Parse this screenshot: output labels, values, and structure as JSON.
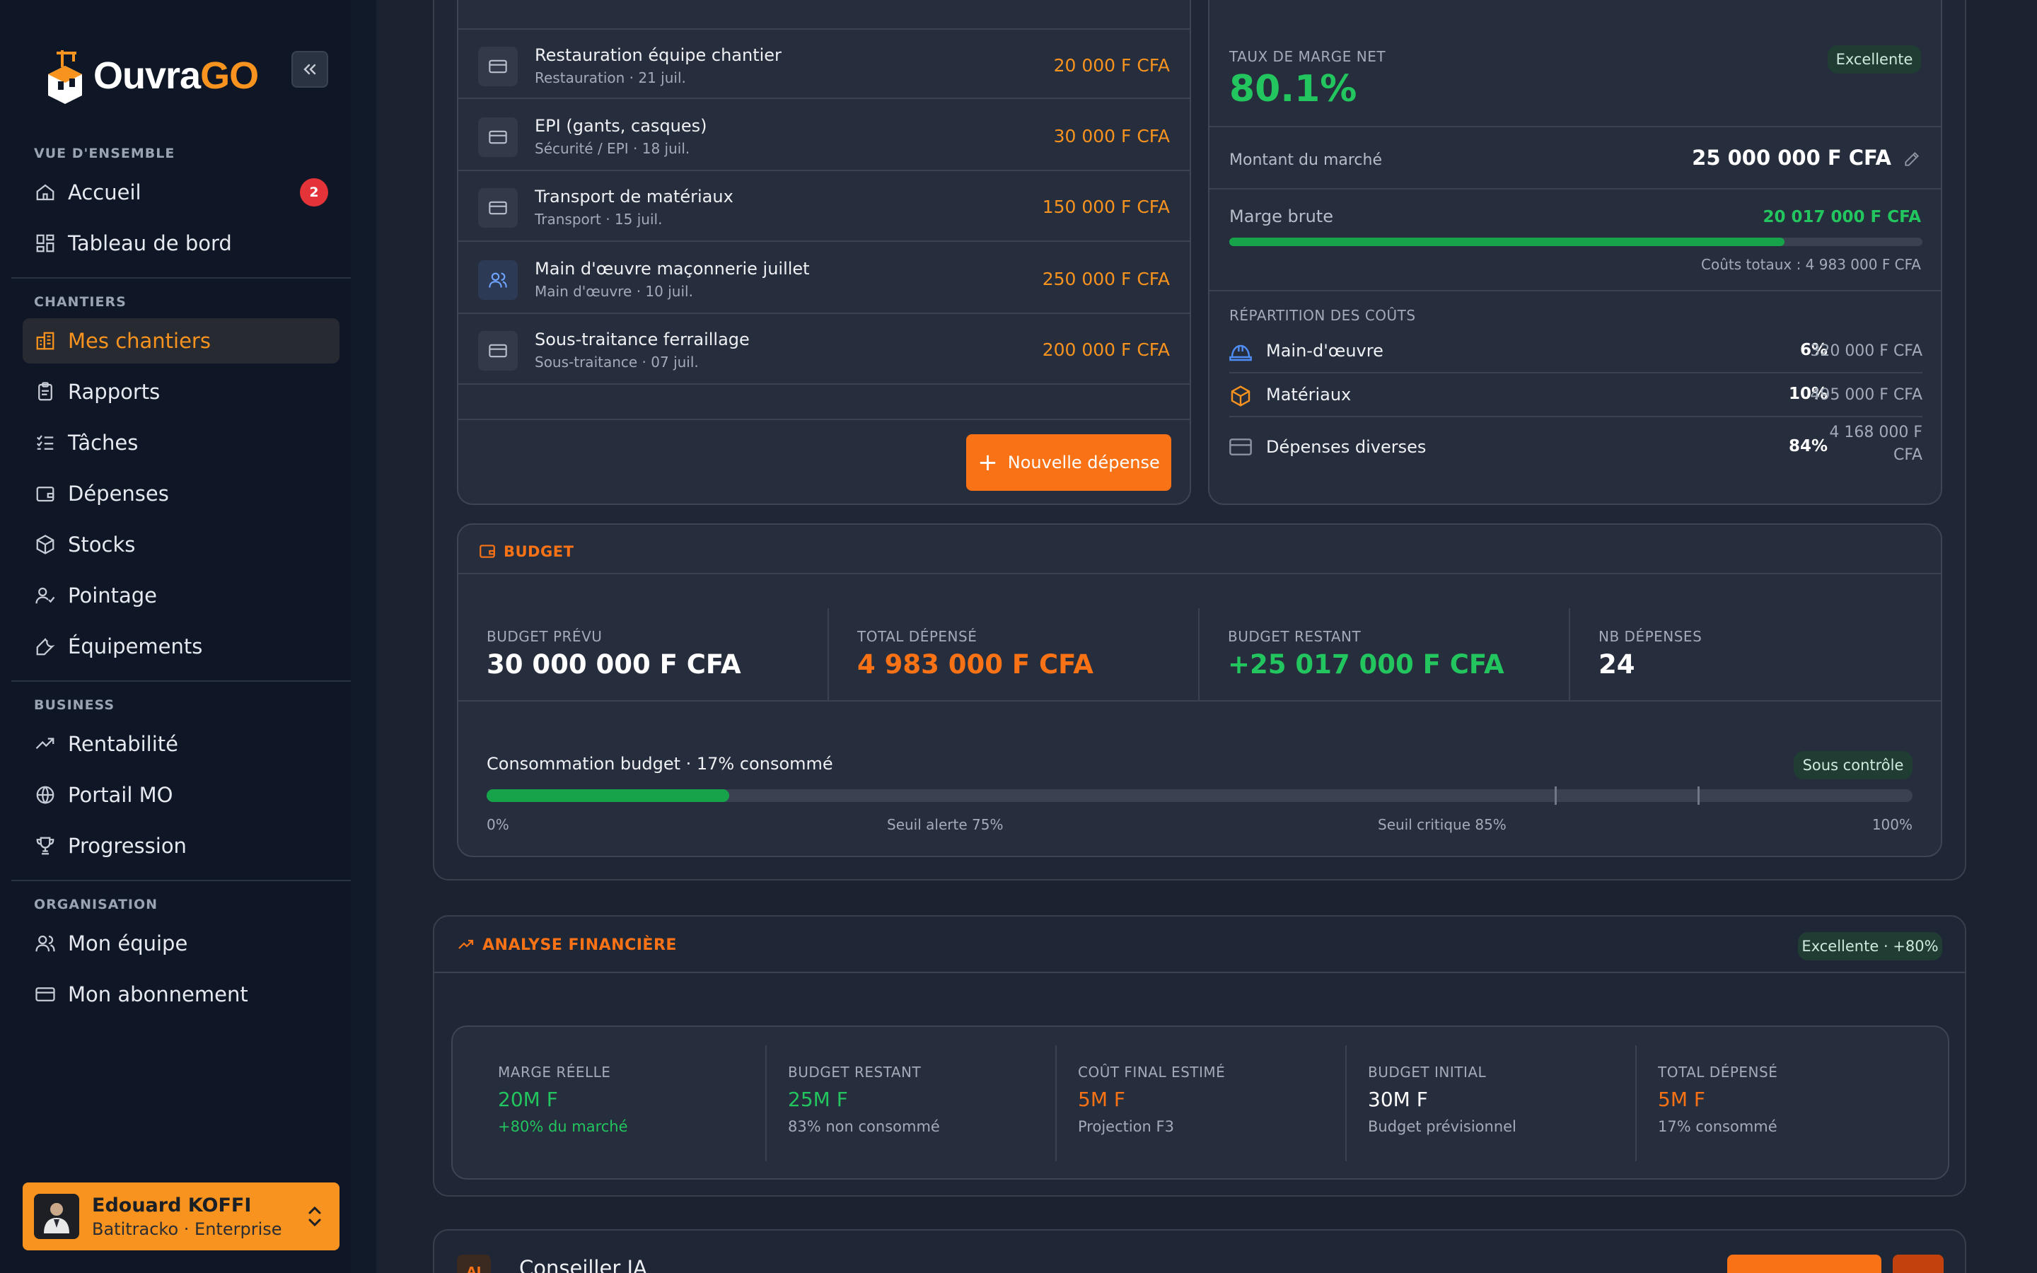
{
  "brand": {
    "name_part1": "Ouvra",
    "name_part2": "GO"
  },
  "sidebar": {
    "sections": [
      {
        "title": "VUE D'ENSEMBLE"
      },
      {
        "title": "CHANTIERS"
      },
      {
        "title": "BUSINESS"
      },
      {
        "title": "ORGANISATION"
      }
    ],
    "items": [
      {
        "label": "Accueil",
        "icon": "home-icon",
        "badge": "2"
      },
      {
        "label": "Tableau de bord",
        "icon": "dashboard-icon"
      },
      {
        "label": "Mes chantiers",
        "icon": "buildings-icon",
        "active": true
      },
      {
        "label": "Rapports",
        "icon": "clipboard-icon"
      },
      {
        "label": "Tâches",
        "icon": "checklist-icon"
      },
      {
        "label": "Dépenses",
        "icon": "wallet-icon"
      },
      {
        "label": "Stocks",
        "icon": "box-icon"
      },
      {
        "label": "Pointage",
        "icon": "user-check-icon"
      },
      {
        "label": "Équipements",
        "icon": "wrench-icon"
      },
      {
        "label": "Rentabilité",
        "icon": "trend-up-icon"
      },
      {
        "label": "Portail MO",
        "icon": "globe-icon"
      },
      {
        "label": "Progression",
        "icon": "trophy-icon"
      },
      {
        "label": "Mon équipe",
        "icon": "users-icon"
      },
      {
        "label": "Mon abonnement",
        "icon": "card-icon"
      }
    ],
    "user": {
      "name": "Edouard KOFFI",
      "subtitle": "Batitracko · Enterprise"
    }
  },
  "expenses": {
    "rows": [
      {
        "title": "Restauration équipe chantier",
        "sub": "Restauration · 21 juil.",
        "amount": "20 000 F CFA",
        "icon": "card-icon"
      },
      {
        "title": "EPI (gants, casques)",
        "sub": "Sécurité / EPI · 18 juil.",
        "amount": "30 000 F CFA",
        "icon": "card-icon"
      },
      {
        "title": "Transport de matériaux",
        "sub": "Transport · 15 juil.",
        "amount": "150 000 F CFA",
        "icon": "card-icon"
      },
      {
        "title": "Main d'œuvre maçonnerie juillet",
        "sub": "Main d'œuvre · 10 juil.",
        "amount": "250 000 F CFA",
        "icon": "users-icon"
      },
      {
        "title": "Sous-traitance ferraillage",
        "sub": "Sous-traitance · 07 juil.",
        "amount": "200 000 F CFA",
        "icon": "card-icon"
      }
    ],
    "new_button": "Nouvelle dépense"
  },
  "margin": {
    "net_label": "TAUX DE MARGE NET",
    "net_value": "80.1%",
    "net_badge": "Excellente",
    "market_label": "Montant du marché",
    "market_value": "25 000 000 F CFA",
    "gross_label": "Marge brute",
    "gross_value": "20 017 000 F CFA",
    "gross_fraction": 0.801,
    "total_costs": "Coûts totaux : 4 983 000 F CFA",
    "breakdown_title": "RÉPARTITION DES COÛTS",
    "breakdown": [
      {
        "label": "Main-d'œuvre",
        "pct": "6%",
        "amount": "320 000 F CFA",
        "icon": "helmet-icon"
      },
      {
        "label": "Matériaux",
        "pct": "10%",
        "amount": "495 000 F CFA",
        "icon": "box-icon"
      },
      {
        "label": "Dépenses diverses",
        "pct": "84%",
        "amount_line1": "4 168 000 F",
        "amount_line2": "CFA",
        "icon": "card-icon"
      }
    ]
  },
  "budget": {
    "title": "BUDGET",
    "stats": [
      {
        "label": "BUDGET PRÉVU",
        "value": "30 000 000 F CFA",
        "color": "#ffffff"
      },
      {
        "label": "TOTAL DÉPENSÉ",
        "value": "4 983 000 F CFA",
        "color": "#f97316"
      },
      {
        "label": "BUDGET RESTANT",
        "value": "+25 017 000 F CFA",
        "color": "#22c55e"
      },
      {
        "label": "NB DÉPENSES",
        "value": "24",
        "color": "#ffffff"
      }
    ],
    "consumption_label": "Consommation budget · 17% consommé",
    "consumption_fraction": 0.17,
    "status_badge": "Sous contrôle",
    "scale": {
      "start": "0%",
      "alert": "Seuil alerte 75%",
      "critical": "Seuil critique 85%",
      "end": "100%"
    }
  },
  "analysis": {
    "title": "ANALYSE FINANCIÈRE",
    "badge": "Excellente · +80%",
    "cards": [
      {
        "label": "MARGE RÉELLE",
        "value": "20M F",
        "sub": "+80% du marché",
        "value_color": "#22c55e",
        "sub_color": "#22c55e"
      },
      {
        "label": "BUDGET RESTANT",
        "value": "25M F",
        "sub": "83% non consommé",
        "value_color": "#22c55e",
        "sub_color": "#a3abb8"
      },
      {
        "label": "COÛT FINAL ESTIMÉ",
        "value": "5M F",
        "sub": "Projection F3",
        "value_color": "#f97316",
        "sub_color": "#a3abb8"
      },
      {
        "label": "BUDGET INITIAL",
        "value": "30M F",
        "sub": "Budget prévisionnel",
        "value_color": "#ffffff",
        "sub_color": "#a3abb8"
      },
      {
        "label": "TOTAL DÉPENSÉ",
        "value": "5M F",
        "sub": "17% consommé",
        "value_color": "#f97316",
        "sub_color": "#a3abb8"
      }
    ]
  },
  "advisor": {
    "title": "Conseiller IA",
    "icon_text": "AI"
  }
}
